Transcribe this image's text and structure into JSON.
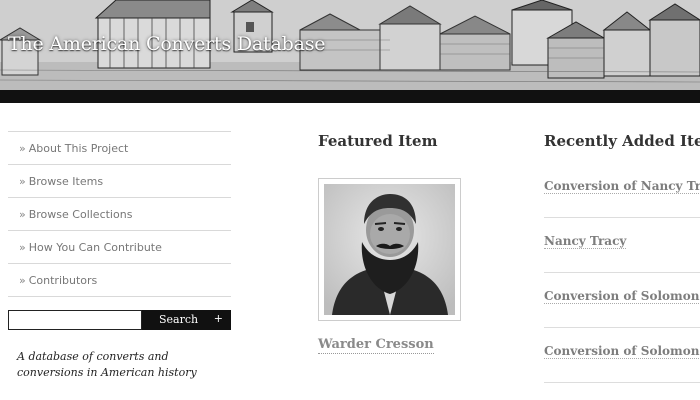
{
  "site": {
    "title": "The American Converts Database"
  },
  "nav": {
    "bullet": "»",
    "items": [
      {
        "label": "About This Project"
      },
      {
        "label": "Browse Items"
      },
      {
        "label": "Browse Collections"
      },
      {
        "label": "How You Can Contribute"
      },
      {
        "label": "Contributors"
      }
    ]
  },
  "search": {
    "value": "",
    "button_label": "Search",
    "toggle_glyph": "+"
  },
  "tagline": "A database of converts and conversions in American history",
  "featured": {
    "heading": "Featured Item",
    "item_title": "Warder Cresson"
  },
  "recent": {
    "heading": "Recently Added Items",
    "items": [
      {
        "title": "Conversion of Nancy Tracy"
      },
      {
        "title": "Nancy Tracy"
      },
      {
        "title": "Conversion of Solomon C"
      },
      {
        "title": "Conversion of Solomon C"
      }
    ]
  },
  "colors": {
    "banner_rule": "#111111",
    "link_gray": "#7d7d7d",
    "heading": "#333333",
    "search_button": "#111111"
  }
}
